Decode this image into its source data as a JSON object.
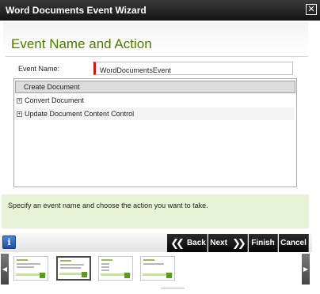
{
  "window": {
    "title": "Word Documents Event Wizard",
    "close_glyph": "✕"
  },
  "page": {
    "title": "Event Name and Action"
  },
  "event_name": {
    "label": "Event Name:",
    "value": "WordDocumentsEvent"
  },
  "actions": {
    "items": [
      {
        "label": "Create Document",
        "selected": true
      },
      {
        "label": "Convert Document",
        "expander": "+"
      },
      {
        "label": "Update Document Content Control",
        "expander": "+"
      }
    ]
  },
  "help": {
    "text": "Specify an event name and choose the action you want to take."
  },
  "buttons": {
    "info": "i",
    "back": "Back",
    "next": "Next",
    "finish": "Finish",
    "cancel": "Cancel",
    "back_glyph": "❮❮",
    "next_glyph": "❯❯"
  },
  "thumbnails": {
    "left_arrow": "◀",
    "right_arrow": "▶",
    "active_index": 1
  },
  "colors": {
    "title_green": "#4d7a00",
    "help_bg": "#e8f2d6",
    "required_marker": "#c51a1a"
  }
}
